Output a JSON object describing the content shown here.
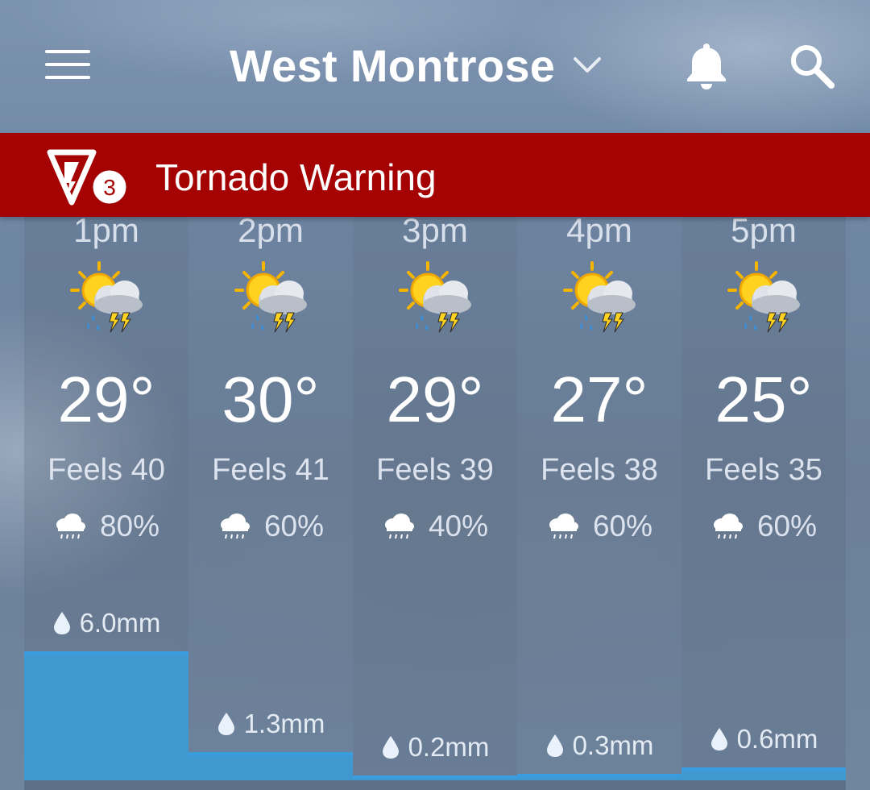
{
  "header": {
    "location": "West Montrose",
    "icons": {
      "menu": "hamburger-menu-icon",
      "dropdown": "chevron-down-icon",
      "notifications": "bell-icon",
      "search": "search-icon"
    }
  },
  "alert": {
    "label": "Tornado Warning",
    "badge_count": "3",
    "background_color": "#a50203"
  },
  "hourly": [
    {
      "time": "1pm",
      "temp": "29°",
      "feels": "Feels 40",
      "pop": "80%",
      "rain": "6.0mm",
      "rain_value": 6.0
    },
    {
      "time": "2pm",
      "temp": "30°",
      "feels": "Feels 41",
      "pop": "60%",
      "rain": "1.3mm",
      "rain_value": 1.3
    },
    {
      "time": "3pm",
      "temp": "29°",
      "feels": "Feels 39",
      "pop": "40%",
      "rain": "0.2mm",
      "rain_value": 0.2
    },
    {
      "time": "4pm",
      "temp": "27°",
      "feels": "Feels 38",
      "pop": "60%",
      "rain": "0.3mm",
      "rain_value": 0.3
    },
    {
      "time": "5pm",
      "temp": "25°",
      "feels": "Feels 35",
      "pop": "60%",
      "rain": "0.6mm",
      "rain_value": 0.6
    }
  ],
  "colors": {
    "rain_bar": "#3f98cf",
    "alert": "#a50203"
  }
}
